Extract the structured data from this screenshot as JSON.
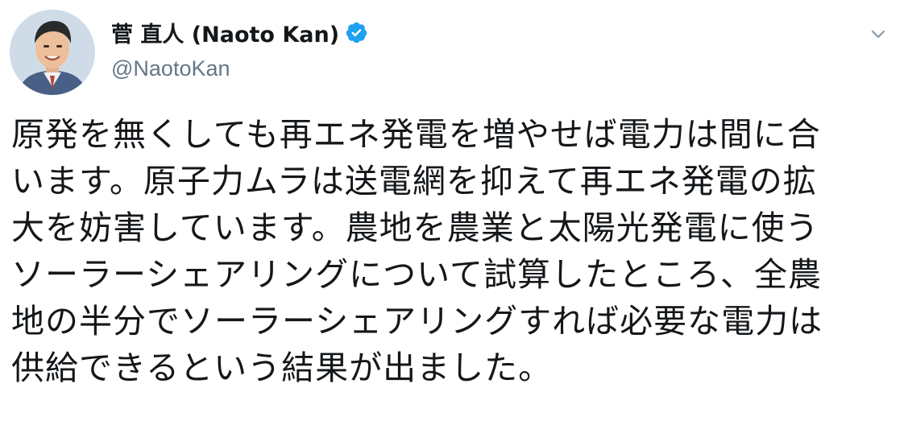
{
  "tweet": {
    "display_name": "菅 直人 (Naoto Kan)",
    "handle": "@NaotoKan",
    "verified": true,
    "avatar_icon": "profile-photo-icon",
    "verified_icon": "verified-badge-icon",
    "more_icon": "chevron-down-icon",
    "text": "原発を無くしても再エネ発電を増やせば電力は間に合\nいます。原子力ムラは送電網を抑えて再エネ発電の拡\n大を妨害しています。農地を農業と太陽光発電に使う\nソーラーシェアリングについて試算したところ、全農\n地の半分でソーラーシェアリングすれば必要な電力は\n供給できるという結果が出ました。",
    "colors": {
      "verified_blue": "#1da1f2",
      "handle_gray": "#657786",
      "text": "#14171a"
    }
  }
}
